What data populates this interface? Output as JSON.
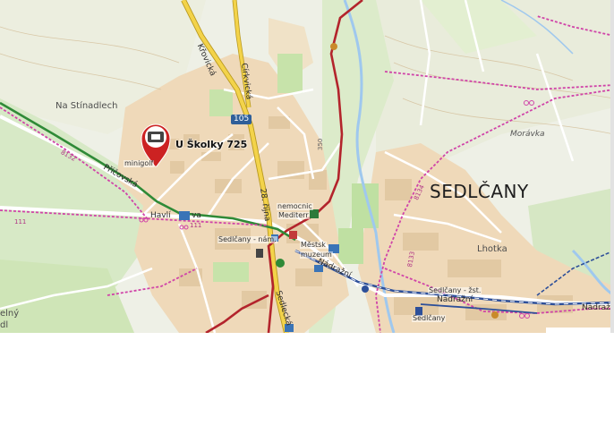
{
  "pin": {
    "title": "U Školky 725",
    "icon": "building-marker-icon",
    "color": "#cc2222"
  },
  "town_label": "SEDLČANY",
  "area_labels": {
    "na_stinadlech": "Na Stínadlech",
    "lhotka": "Lhotka",
    "moravka": "Morávka",
    "elny_dl": "elný",
    "elny_dl2": "dl"
  },
  "street_labels": {
    "krovicka": "Křovická",
    "cirkvicka": "Církvická",
    "osmadvacatehorijna": "28. října",
    "havlicekova_a": "Havlí",
    "havlicekova_b": "va",
    "pricovska": "Příčovská",
    "sedlecka": "Sedlecká",
    "nadrazni1": "Nádražní",
    "nadrazni2": "Nádražní",
    "nadrazni3": "Nádražní"
  },
  "poi_labels": {
    "minigolf": "minigolf",
    "nemocnice": "nemocnic",
    "mediterr": "Mediterr",
    "sedlcany_nam": "Sedlčany - nám.",
    "muzeum1": "Městsk",
    "muzeum2": "muzeum",
    "sedlcany_zst": "Sedlčany - žst.",
    "sedlcany_stn": "Sedlčany"
  },
  "road_numbers": {
    "r105": "105",
    "r111a": "111",
    "r111b": "111",
    "r8132": "8132",
    "r350": "350",
    "r8134": "8134",
    "r8133": "8133"
  },
  "colors": {
    "built_up": "#efd9b9",
    "park": "#c7e3aa",
    "water": "#9fc8ee",
    "main_road": "#f3d34a",
    "rail": "#2d4f99",
    "route_red": "#b3242c",
    "route_green": "#2f8a37",
    "route_pink": "#d044a8"
  }
}
